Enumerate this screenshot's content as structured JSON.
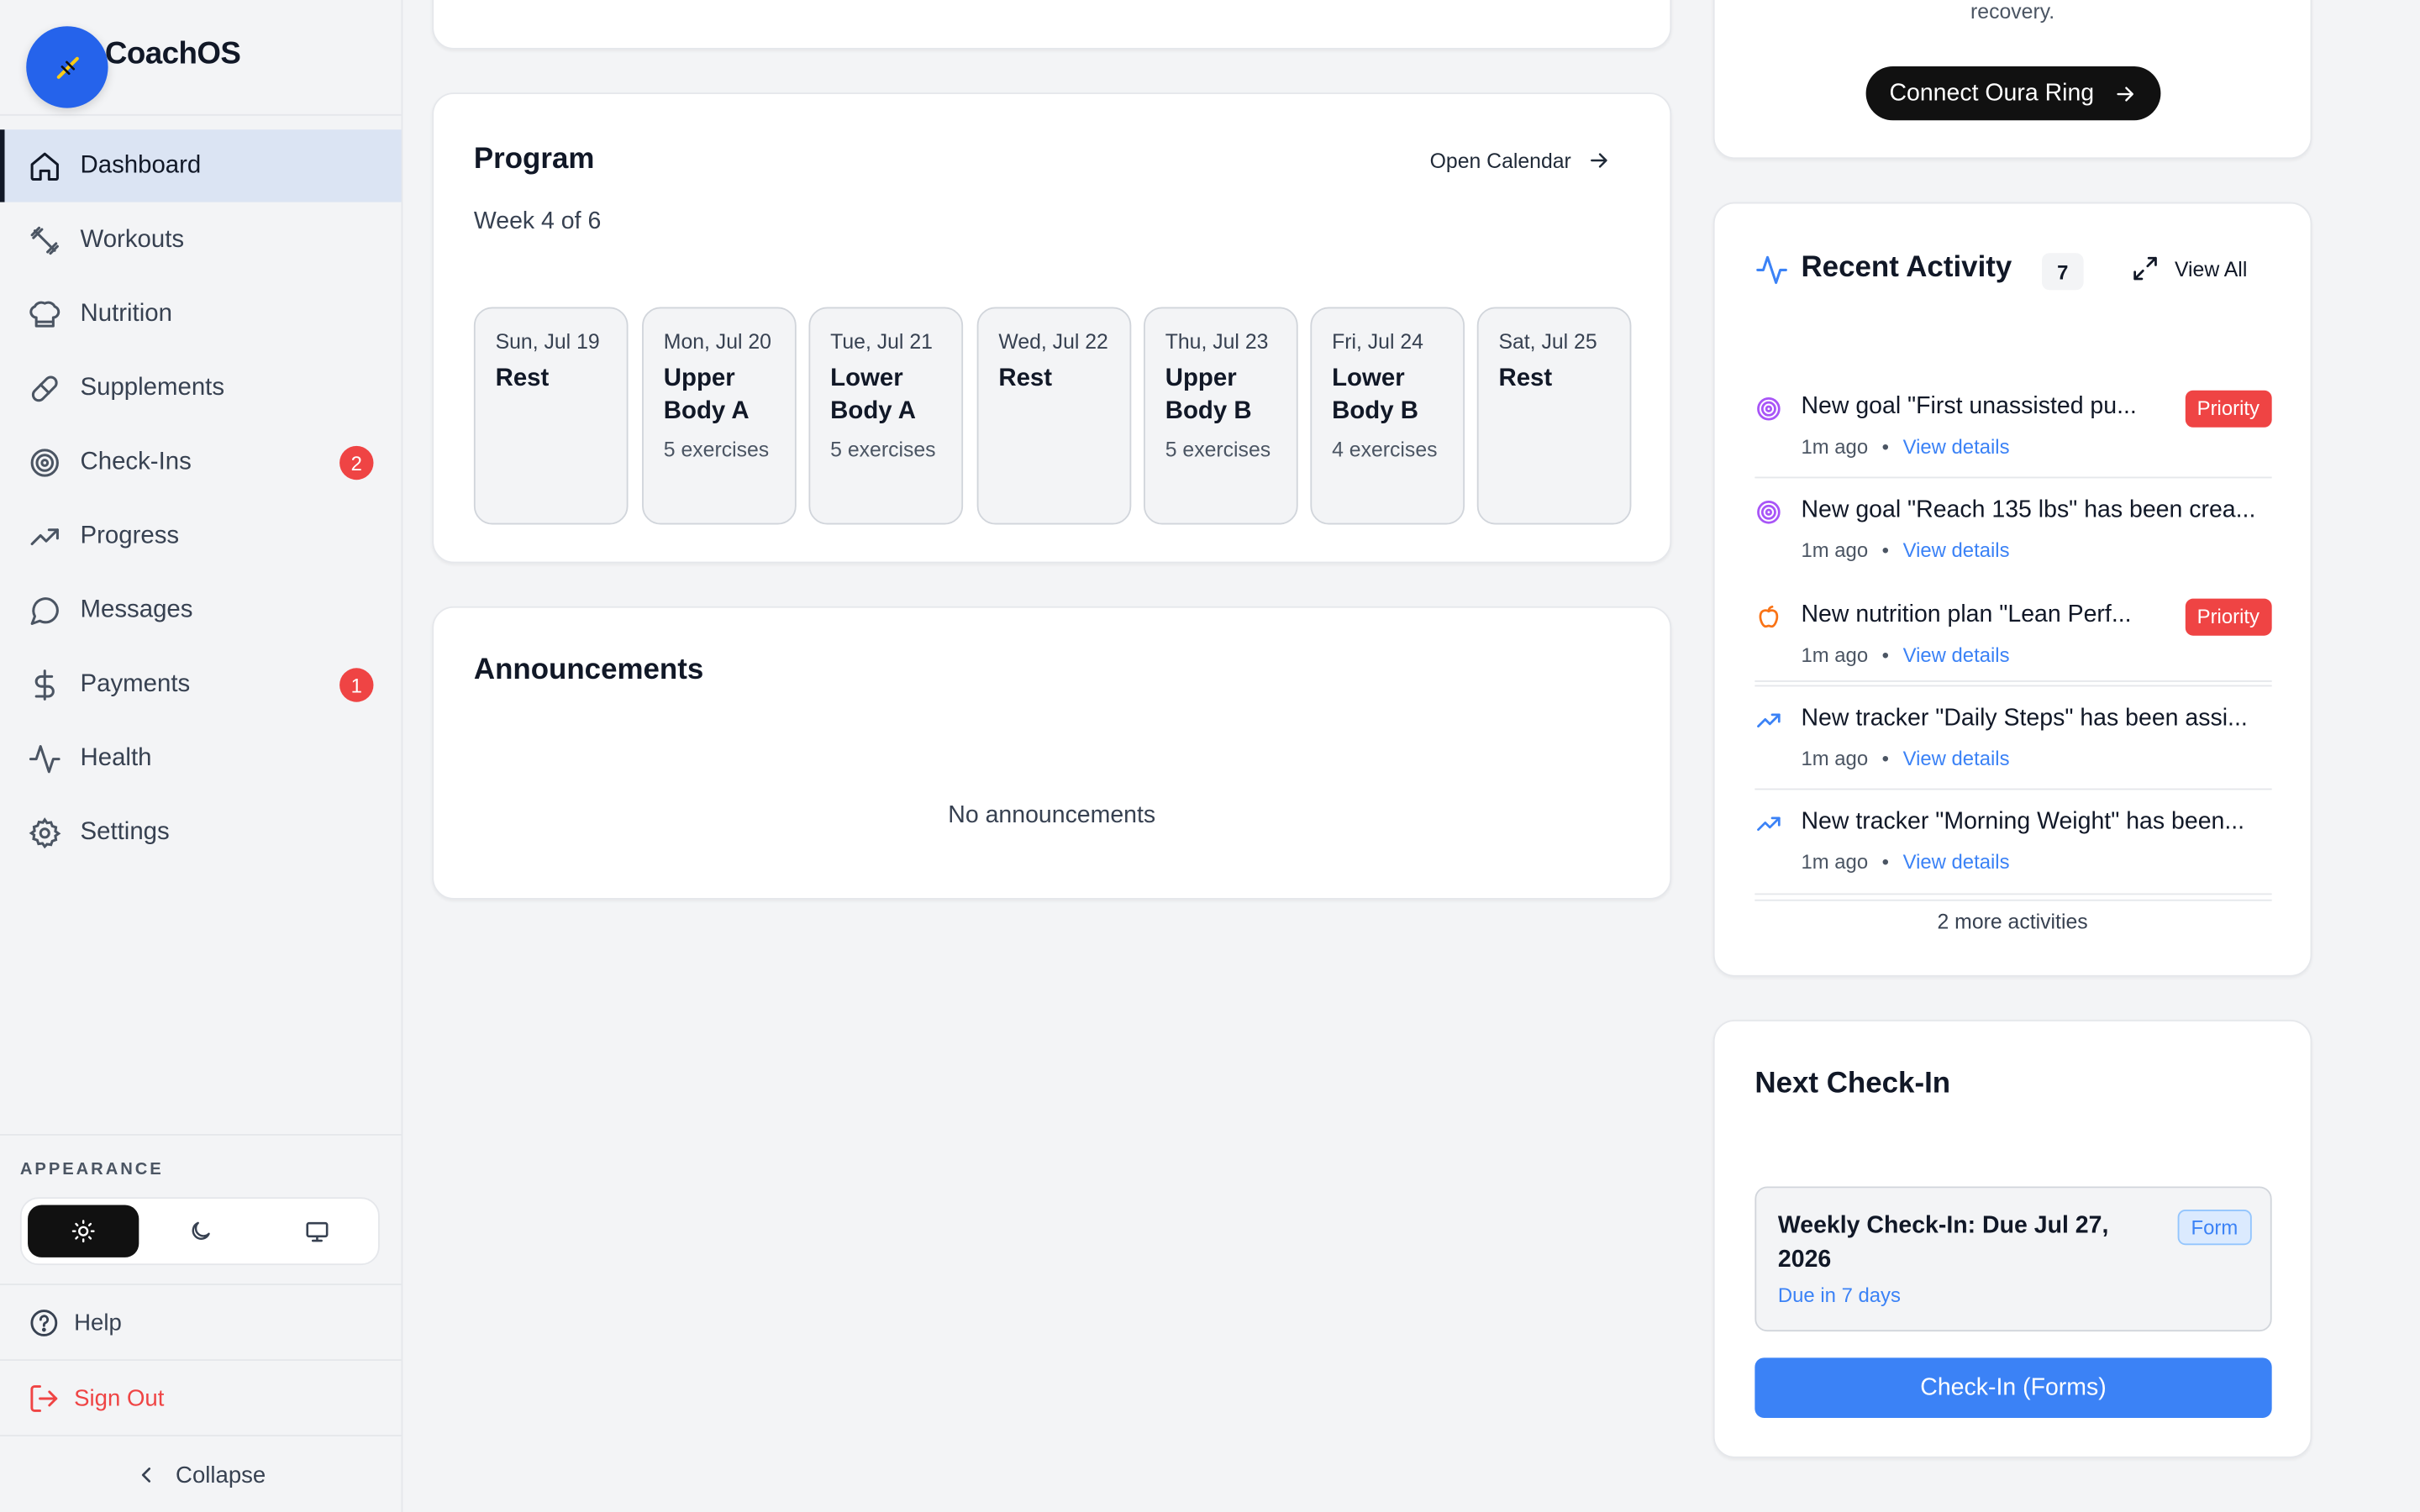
{
  "app": {
    "name": "CoachOS"
  },
  "sidebar": {
    "items": [
      {
        "label": "Dashboard",
        "icon": "home-icon",
        "active": true
      },
      {
        "label": "Workouts",
        "icon": "dumbbell-icon"
      },
      {
        "label": "Nutrition",
        "icon": "chef-hat-icon"
      },
      {
        "label": "Supplements",
        "icon": "pill-icon"
      },
      {
        "label": "Check-Ins",
        "icon": "target-icon",
        "badge": "2"
      },
      {
        "label": "Progress",
        "icon": "trending-up-icon"
      },
      {
        "label": "Messages",
        "icon": "message-icon"
      },
      {
        "label": "Payments",
        "icon": "dollar-icon",
        "badge": "1"
      },
      {
        "label": "Health",
        "icon": "activity-icon"
      },
      {
        "label": "Settings",
        "icon": "gear-icon"
      }
    ],
    "appearance_label": "APPEARANCE",
    "help_label": "Help",
    "signout_label": "Sign Out",
    "collapse_label": "Collapse"
  },
  "oura": {
    "description_tail": "readiness based on sleep, HRV, and recovery.",
    "button_label": "Connect Oura Ring"
  },
  "program": {
    "title": "Program",
    "open_calendar": "Open Calendar",
    "week": "Week 4 of 6",
    "days": [
      {
        "date": "Sun, Jul 19",
        "workout": "Rest",
        "exercises": ""
      },
      {
        "date": "Mon, Jul 20",
        "workout": "Upper Body A",
        "exercises": "5 exercises"
      },
      {
        "date": "Tue, Jul 21",
        "workout": "Lower Body A",
        "exercises": "5 exercises"
      },
      {
        "date": "Wed, Jul 22",
        "workout": "Rest",
        "exercises": ""
      },
      {
        "date": "Thu, Jul 23",
        "workout": "Upper Body B",
        "exercises": "5 exercises"
      },
      {
        "date": "Fri, Jul 24",
        "workout": "Lower Body B",
        "exercises": "4 exercises"
      },
      {
        "date": "Sat, Jul 25",
        "workout": "Rest",
        "exercises": ""
      }
    ]
  },
  "announcements": {
    "title": "Announcements",
    "empty": "No announcements"
  },
  "activity": {
    "title": "Recent Activity",
    "count": "7",
    "view_all": "View All",
    "items": [
      {
        "icon": "target-icon",
        "text": "New goal \"First unassisted pu...",
        "time": "1m ago",
        "link": "View details",
        "priority": "Priority"
      },
      {
        "icon": "target-icon",
        "text": "New goal \"Reach 135 lbs\" has been crea...",
        "time": "1m ago",
        "link": "View details"
      },
      {
        "icon": "apple-icon",
        "text": "New nutrition plan \"Lean Perf...",
        "time": "1m ago",
        "link": "View details",
        "priority": "Priority"
      },
      {
        "icon": "trending-up-icon",
        "text": "New tracker \"Daily Steps\" has been assi...",
        "time": "1m ago",
        "link": "View details"
      },
      {
        "icon": "trending-up-icon",
        "text": "New tracker \"Morning Weight\" has been...",
        "time": "1m ago",
        "link": "View details"
      }
    ],
    "more": "2 more activities"
  },
  "checkin": {
    "title": "Next Check-In",
    "item_title": "Weekly Check-In: Due Jul 27, 2026",
    "due": "Due in 7 days",
    "tag": "Form",
    "button": "Check-In (Forms)"
  },
  "colors": {
    "accent": "#3b82f6",
    "badge": "#ef4444",
    "purple": "#a855f7",
    "orange": "#f97316"
  }
}
